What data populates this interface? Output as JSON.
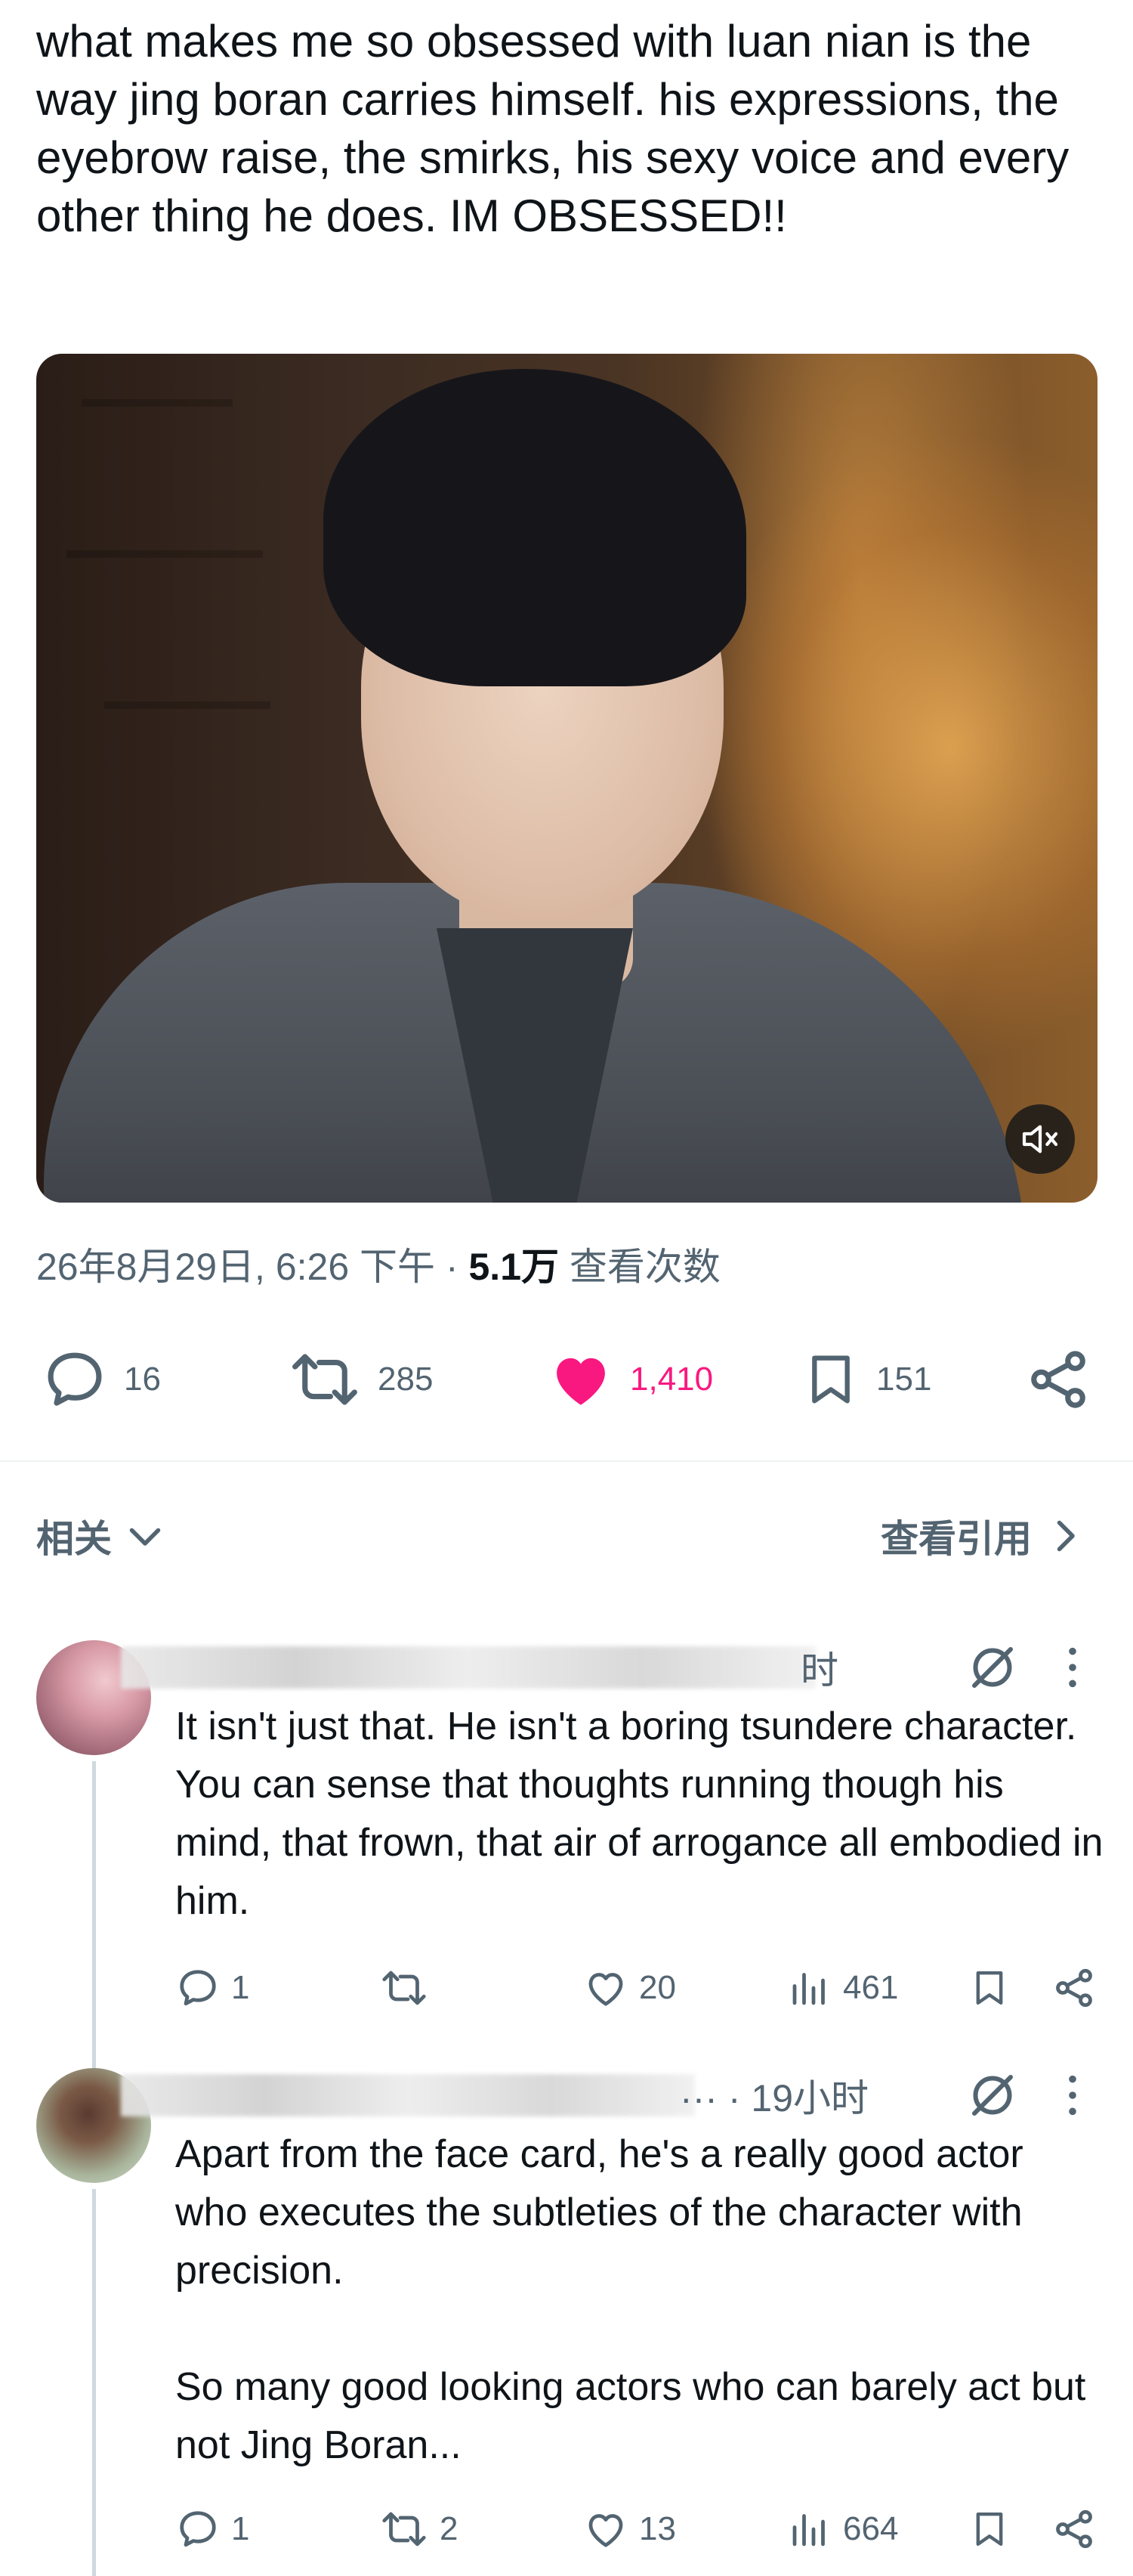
{
  "post": {
    "text": "what makes me so obsessed with luan nian is the way jing boran carries himself. his expressions, the eyebrow raise, the smirks, his sexy voice and every other thing he does. IM OBSESSED!!",
    "timestamp": "26年8月29日, 6:26 下午",
    "separator": "·",
    "views_count": "5.1万",
    "views_label": "查看次数",
    "actions": {
      "replies": "16",
      "reposts": "285",
      "likes": "1,410",
      "bookmarks": "151"
    },
    "like_color": "#f91880"
  },
  "related": {
    "label": "相关",
    "view_quotes": "查看引用"
  },
  "replies": [
    {
      "time": "时",
      "text": "It isn't just that. He isn't a boring tsundere character. You can sense that thoughts running though his mind, that frown, that air of arrogance all embodied in him.",
      "actions": {
        "replies": "1",
        "reposts": "",
        "likes": "20",
        "views": "461"
      }
    },
    {
      "time": "··· · 19小时",
      "text": "Apart from the face card, he's a really good actor who executes the subtleties of the character with precision.\n\nSo many good looking actors who can barely act but not Jing Boran...",
      "actions": {
        "replies": "1",
        "reposts": "2",
        "likes": "13",
        "views": "664"
      }
    }
  ]
}
